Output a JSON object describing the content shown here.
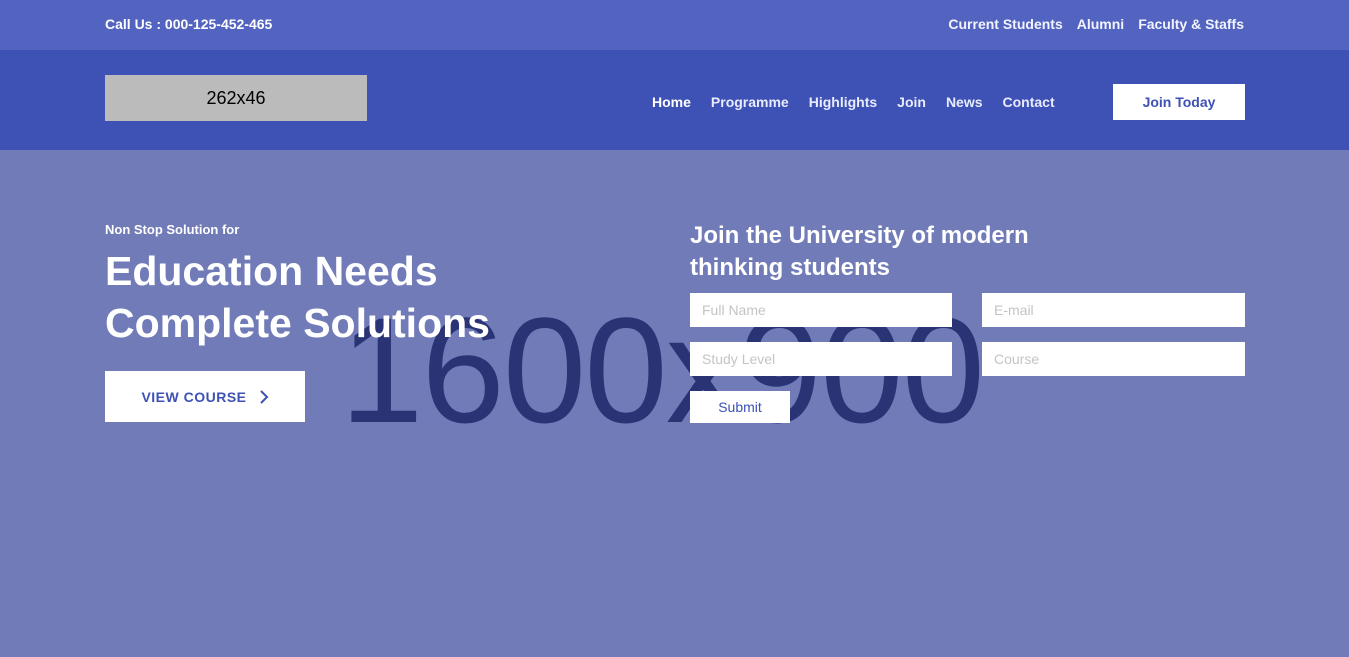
{
  "topbar": {
    "call_label": "Call Us : 000-125-452-465",
    "links": [
      "Current Students",
      "Alumni",
      "Faculty & Staffs"
    ]
  },
  "navbar": {
    "logo_text": "262x46",
    "menu": [
      "Home",
      "Programme",
      "Highlights",
      "Join",
      "News",
      "Contact"
    ],
    "cta_label": "Join Today"
  },
  "hero": {
    "background_text": "1600x900",
    "eyebrow": "Non Stop Solution for",
    "headline": "Education Needs Complete Solutions",
    "view_course_label": "VIEW COURSE"
  },
  "form": {
    "title": "Join the University of modern thinking students",
    "full_name_placeholder": "Full Name",
    "email_placeholder": "E-mail",
    "study_level_placeholder": "Study Level",
    "course_placeholder": "Course",
    "submit_label": "Submit"
  },
  "colors": {
    "topbar": "#5264c0",
    "navbar": "#3e51b5",
    "hero": "#717bb8",
    "accent": "#3e51b5"
  }
}
